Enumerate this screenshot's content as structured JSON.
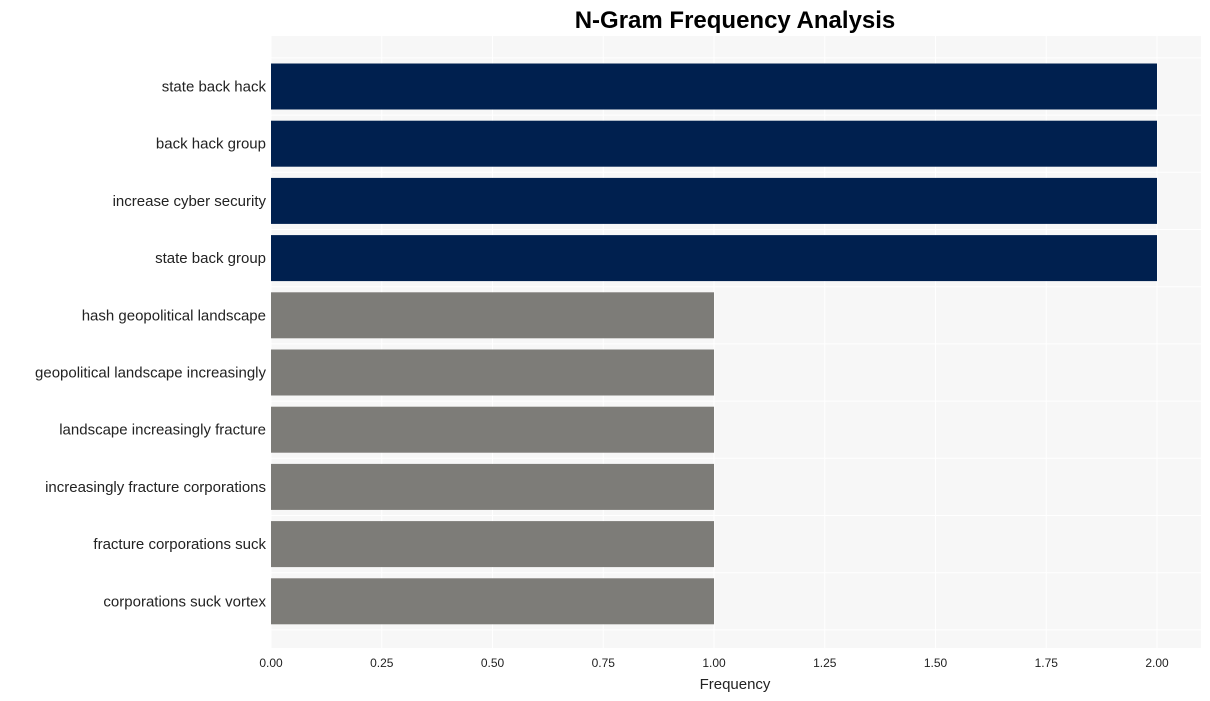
{
  "chart_data": {
    "type": "bar",
    "orientation": "horizontal",
    "title": "N-Gram Frequency Analysis",
    "xlabel": "Frequency",
    "ylabel": "",
    "xlim": [
      0,
      2.0
    ],
    "xticks": [
      "0.00",
      "0.25",
      "0.50",
      "0.75",
      "1.00",
      "1.25",
      "1.50",
      "1.75",
      "2.00"
    ],
    "xtick_values": [
      0,
      0.25,
      0.5,
      0.75,
      1.0,
      1.25,
      1.5,
      1.75,
      2.0
    ],
    "grid": true,
    "categories": [
      "state back hack",
      "back hack group",
      "increase cyber security",
      "state back group",
      "hash geopolitical landscape",
      "geopolitical landscape increasingly",
      "landscape increasingly fracture",
      "increasingly fracture corporations",
      "fracture corporations suck",
      "corporations suck vortex"
    ],
    "values": [
      2,
      2,
      2,
      2,
      1,
      1,
      1,
      1,
      1,
      1
    ],
    "colors": {
      "high": "#00204f",
      "low": "#7d7c78",
      "plot_background": "#f7f7f7",
      "grid": "#ffffff"
    }
  }
}
